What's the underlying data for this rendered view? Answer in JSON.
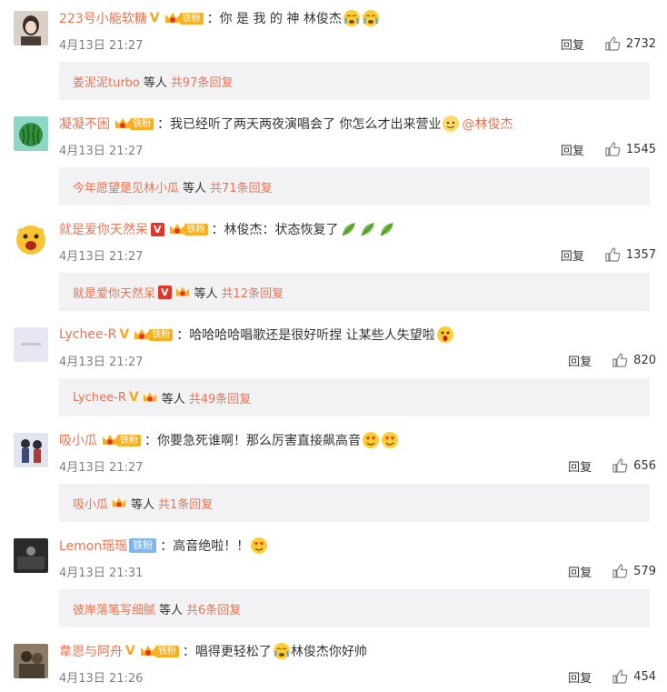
{
  "labels": {
    "reply": "回复",
    "others": "等人"
  },
  "comments": [
    {
      "user": "223号小能软糖",
      "badge_v": "V",
      "fan_tag": "铁粉",
      "text": "：你 是 我 的 神 林俊杰",
      "emojis": [
        "crying-face-icon",
        "crying-face-icon"
      ],
      "time": "4月13日 21:27",
      "likes": "2732",
      "reply_user": "姜泥泥turbo",
      "reply_total": "共97条回复"
    },
    {
      "user": "凝凝不困",
      "fan_tag": "铁粉",
      "text": "：我已经听了两天两夜演唱会了 你怎么才出来营业",
      "mention": "@林俊杰",
      "time": "4月13日 21:27",
      "likes": "1545",
      "reply_user": "今年愿望是见林小瓜",
      "reply_total": "共71条回复"
    },
    {
      "user": "就是爱你天然呆",
      "badge_v": "V",
      "fan_tag": "铁粉",
      "text": "：林俊杰：状态恢复了",
      "time": "4月13日 21:27",
      "likes": "1357",
      "reply_user": "就是爱你天然呆",
      "reply_total": "共12条回复"
    },
    {
      "user": "Lychee-R",
      "badge_v": "V",
      "fan_tag": "铁粉",
      "text": "：哈哈哈哈唱歌还是很好听捏 让某些人失望啦",
      "time": "4月13日 21:27",
      "likes": "820",
      "reply_user": "Lychee-R",
      "reply_total": "共49条回复"
    },
    {
      "user": "吸小瓜",
      "fan_tag": "铁粉",
      "text": "：你要急死谁啊！那么厉害直接飙高音",
      "time": "4月13日 21:27",
      "likes": "656",
      "reply_user": "吸小瓜",
      "reply_total": "共1条回复"
    },
    {
      "user": "Lemon瑶瑶",
      "fan_tag": "铁粉",
      "text": "：高音绝啦！！",
      "time": "4月13日 21:31",
      "likes": "579",
      "reply_user": "彼岸落笔写细腻",
      "reply_total": "共6条回复"
    },
    {
      "user": "韋恩与阿舟",
      "badge_v": "V",
      "fan_tag": "铁粉",
      "text": "：唱得更轻松了",
      "text2": "林俊杰你好帅",
      "time": "4月13日 21:26",
      "likes": "454"
    }
  ],
  "colors": {
    "username": "#eb7350",
    "reply_box": "#f2f2f5",
    "fan_tag": "#f8b022",
    "fan_tag_blue": "#80b8ec"
  }
}
